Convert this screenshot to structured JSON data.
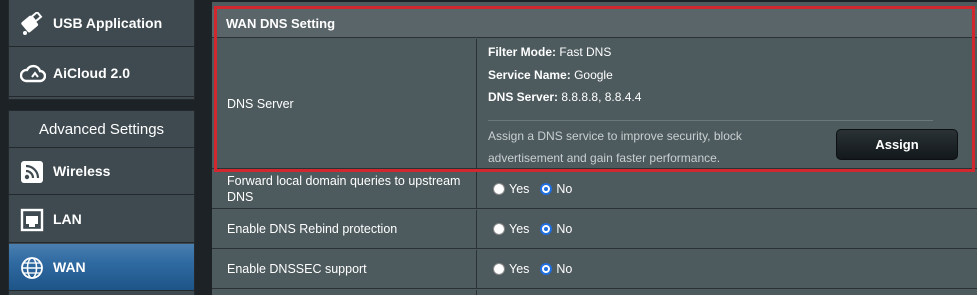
{
  "sidebar": {
    "top_items": [
      {
        "label": "USB Application",
        "icon": "usb-icon"
      },
      {
        "label": "AiCloud 2.0",
        "icon": "cloud-icon"
      }
    ],
    "advanced_header": "Advanced Settings",
    "advanced_items": [
      {
        "label": "Wireless",
        "icon": "wifi-icon",
        "active": false
      },
      {
        "label": "LAN",
        "icon": "lan-icon",
        "active": false
      },
      {
        "label": "WAN",
        "icon": "globe-icon",
        "active": true
      }
    ]
  },
  "panel": {
    "title": "WAN DNS Setting",
    "dns_server": {
      "label": "DNS Server",
      "filter_mode_key": "Filter Mode:",
      "filter_mode_value": "Fast DNS",
      "service_name_key": "Service Name:",
      "service_name_value": "Google",
      "dns_server_key": "DNS Server:",
      "dns_server_value": "8.8.8.8, 8.8.4.4",
      "description": "Assign a DNS service to improve security, block advertisement and gain faster performance.",
      "assign_label": "Assign"
    },
    "options": [
      {
        "label": "Forward local domain queries to upstream DNS",
        "yes": "Yes",
        "no": "No",
        "selected": "No"
      },
      {
        "label": "Enable DNS Rebind protection",
        "yes": "Yes",
        "no": "No",
        "selected": "No"
      },
      {
        "label": "Enable DNSSEC support",
        "yes": "Yes",
        "no": "No",
        "selected": "No"
      }
    ]
  },
  "colors": {
    "highlight": "#d0282e",
    "active_nav": "#2f6aa1",
    "panel_bg": "#4d5a5e",
    "radio_checked": "#1f6fe0"
  }
}
